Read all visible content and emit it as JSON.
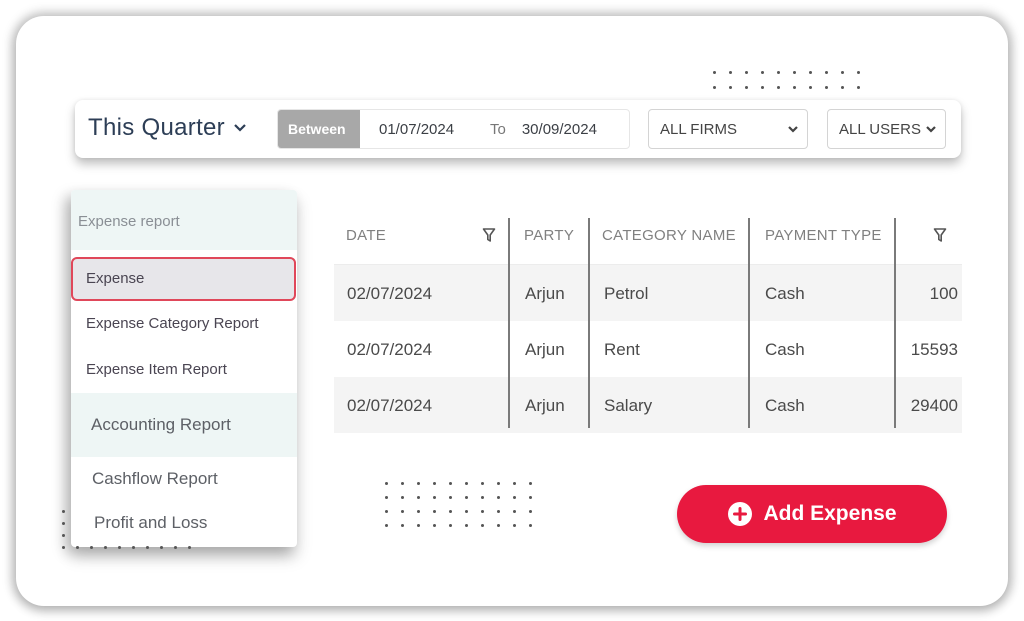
{
  "filter_bar": {
    "period_label": "This Quarter",
    "between_label": "Between",
    "date_from": "01/07/2024",
    "to_label": "To",
    "date_to": "30/09/2024",
    "firm_select": "ALL FIRMS",
    "user_select": "ALL USERS"
  },
  "menu": {
    "group1_title": "Expense report",
    "items": [
      {
        "label": "Expense",
        "active": true
      },
      {
        "label": "Expense Category Report"
      },
      {
        "label": "Expense Item Report"
      }
    ],
    "group2_title": "Accounting Report",
    "sub_items": [
      {
        "label": "Cashflow Report"
      },
      {
        "label": "Profit and Loss"
      }
    ]
  },
  "table": {
    "headers": [
      "DATE",
      "PARTY",
      "CATEGORY NAME",
      "PAYMENT TYPE",
      ""
    ],
    "rows": [
      [
        "02/07/2024",
        "Arjun",
        "Petrol",
        "Cash",
        "100"
      ],
      [
        "02/07/2024",
        "Arjun",
        "Rent",
        "Cash",
        "15593"
      ],
      [
        "02/07/2024",
        "Arjun",
        "Salary",
        "Cash",
        "29400"
      ]
    ]
  },
  "actions": {
    "add_expense_label": "Add Expense"
  },
  "colors": {
    "accent_red": "#e8193f",
    "active_border": "#e0475a",
    "title_navy": "#2d3e56",
    "menu_header_bg": "#eef6f5"
  }
}
